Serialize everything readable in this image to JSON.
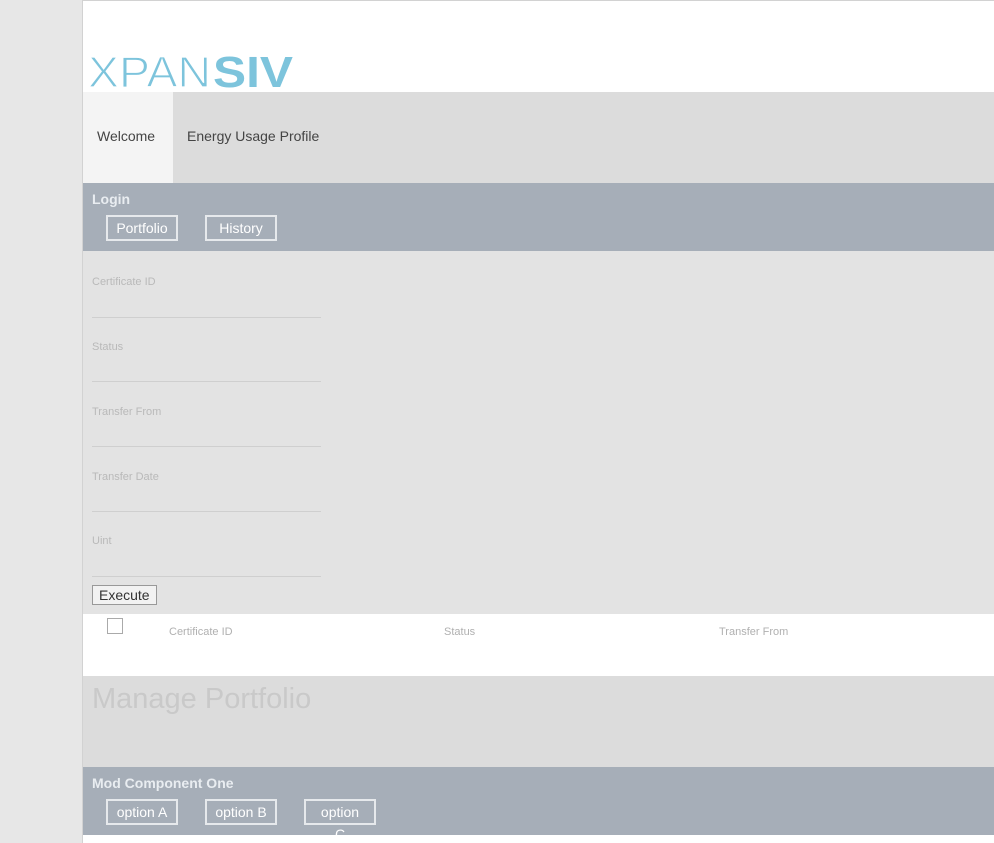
{
  "logo": {
    "text_light": "XPAN",
    "text_bold": "SIV",
    "color": "#7dc4dc"
  },
  "nav": {
    "tabs": [
      {
        "label": "Welcome",
        "active": true
      },
      {
        "label": "Energy Usage Profile",
        "active": false
      }
    ]
  },
  "login_panel": {
    "title": "Login",
    "buttons": [
      "Portfolio",
      "History"
    ]
  },
  "form": {
    "fields": [
      {
        "label": "Certificate ID",
        "value": ""
      },
      {
        "label": "Status",
        "value": ""
      },
      {
        "label": "Transfer From",
        "value": ""
      },
      {
        "label": "Transfer Date",
        "value": ""
      },
      {
        "label": "Uint",
        "value": ""
      }
    ],
    "execute_label": "Execute"
  },
  "table": {
    "columns": [
      "Certificate ID",
      "Status",
      "Transfer From"
    ]
  },
  "manage": {
    "title": "Manage Portfolio"
  },
  "mod_panel": {
    "title": "Mod Component One",
    "buttons": [
      "option A",
      "option B",
      "option C"
    ]
  },
  "colors": {
    "panel_bar": "#a6aeb8",
    "nav_bg": "#dcdcdc",
    "form_bg": "#e3e3e3",
    "accent_logo": "#7dc4dc"
  }
}
